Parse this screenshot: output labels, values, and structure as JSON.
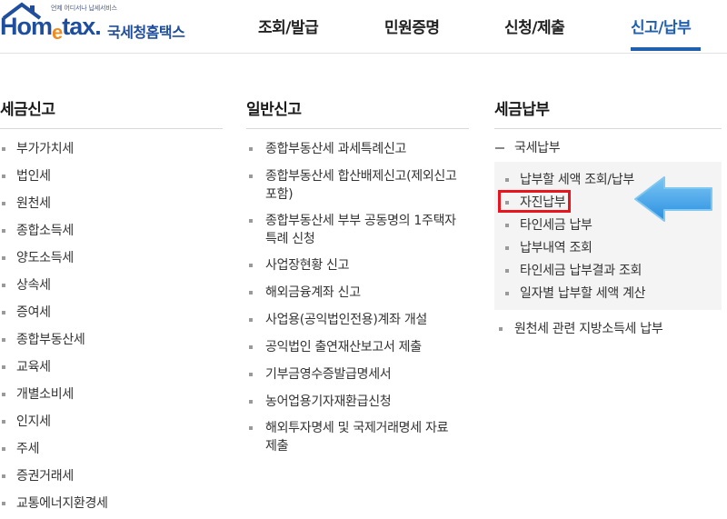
{
  "header": {
    "logo": {
      "tagline": "언제 어디서나 납세서비스",
      "brand_main": "Hom",
      "brand_e": "e",
      "brand_rest": "tax",
      "brand_dot": ".",
      "subtitle": "국세청홈택스"
    },
    "nav": [
      {
        "label": "조회/발급"
      },
      {
        "label": "민원증명"
      },
      {
        "label": "신청/제출"
      },
      {
        "label": "신고/납부"
      }
    ]
  },
  "columns": {
    "tax_filing": {
      "title": "세금신고",
      "items": [
        "부가가치세",
        "법인세",
        "원천세",
        "종합소득세",
        "양도소득세",
        "상속세",
        "증여세",
        "종합부동산세",
        "교육세",
        "개별소비세",
        "인지세",
        "주세",
        "증권거래세",
        "교통에너지환경세"
      ]
    },
    "general_filing": {
      "title": "일반신고",
      "items": [
        {
          "line1": "종합부동산세 과세특례신고"
        },
        {
          "line1": "종합부동산세 합산배제신고(제외신고",
          "line2": "포함)"
        },
        {
          "line1": "종합부동산세 부부 공동명의 1주택자",
          "line2": "특례 신청"
        },
        {
          "line1": "사업장현황 신고"
        },
        {
          "line1": "해외금융계좌 신고"
        },
        {
          "line1": "사업용(공익법인전용)계좌 개설"
        },
        {
          "line1": "공익법인 출연재산보고서 제출"
        },
        {
          "line1": "기부금영수증발급명세서"
        },
        {
          "line1": "농어업용기자재환급신청"
        },
        {
          "line1": "해외투자명세 및 국제거래명세 자료",
          "line2": "제출"
        }
      ]
    },
    "tax_payment": {
      "title": "세금납부",
      "group_label": "국세납부",
      "sub_items": [
        "납부할 세액 조회/납부",
        "자진납부",
        "타인세금 납부",
        "납부내역 조회",
        "타인세금 납부결과 조회",
        "일자별 납부할 세액 계산"
      ],
      "extra_item": "원천세 관련 지방소득세 납부"
    }
  },
  "colors": {
    "brand_blue": "#1f4e9c",
    "nav_active": "#1f5fae",
    "highlight_red": "#e8141e",
    "arrow_blue": "#3aa0e8"
  }
}
